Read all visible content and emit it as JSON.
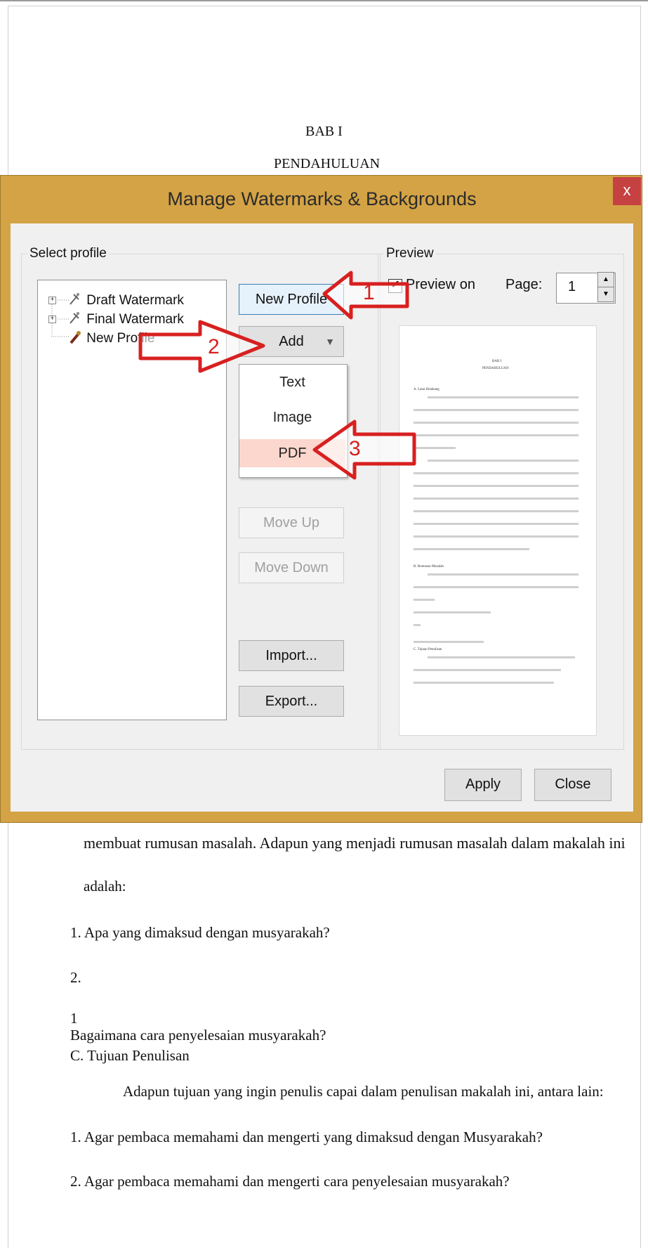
{
  "document": {
    "chapter": "BAB I",
    "chapter_title": "PENDAHULUAN",
    "lines": [
      "membuat rumusan masalah. Adapun yang menjadi rumusan masalah dalam makalah ini",
      "adalah:",
      "1. Apa yang dimaksud dengan musyarakah?",
      "2.",
      "1",
      "Bagaimana cara penyelesaian musyarakah?",
      "C. Tujuan Penulisan",
      "Adapun tujuan yang ingin penulis capai dalam penulisan makalah ini, antara lain:",
      "1. Agar pembaca memahami dan mengerti yang dimaksud dengan Musyarakah?",
      "2. Agar pembaca memahami dan mengerti cara penyelesaian musyarakah?"
    ]
  },
  "dialog": {
    "title": "Manage Watermarks & Backgrounds",
    "close_label": "x",
    "select_profile_label": "Select profile",
    "profiles": [
      "Draft Watermark",
      "Final Watermark",
      "New Profile"
    ],
    "buttons": {
      "new_profile": "New Profile",
      "add": "Add",
      "move_up": "Move Up",
      "move_down": "Move Down",
      "import": "Import...",
      "export": "Export...",
      "apply": "Apply",
      "close": "Close"
    },
    "add_menu": [
      "Text",
      "Image",
      "PDF"
    ],
    "preview": {
      "group_label": "Preview",
      "checkbox_label": "Preview on",
      "checkbox_checked": true,
      "page_label": "Page:",
      "page_value": "1"
    }
  },
  "annotations": {
    "arrow_1": "1",
    "arrow_2": "2",
    "arrow_3": "3"
  },
  "colors": {
    "dialog_frame": "#d4a345",
    "close_button": "#c64141",
    "annotation_red": "#d82020",
    "menu_highlight": "#fbd7cd"
  }
}
